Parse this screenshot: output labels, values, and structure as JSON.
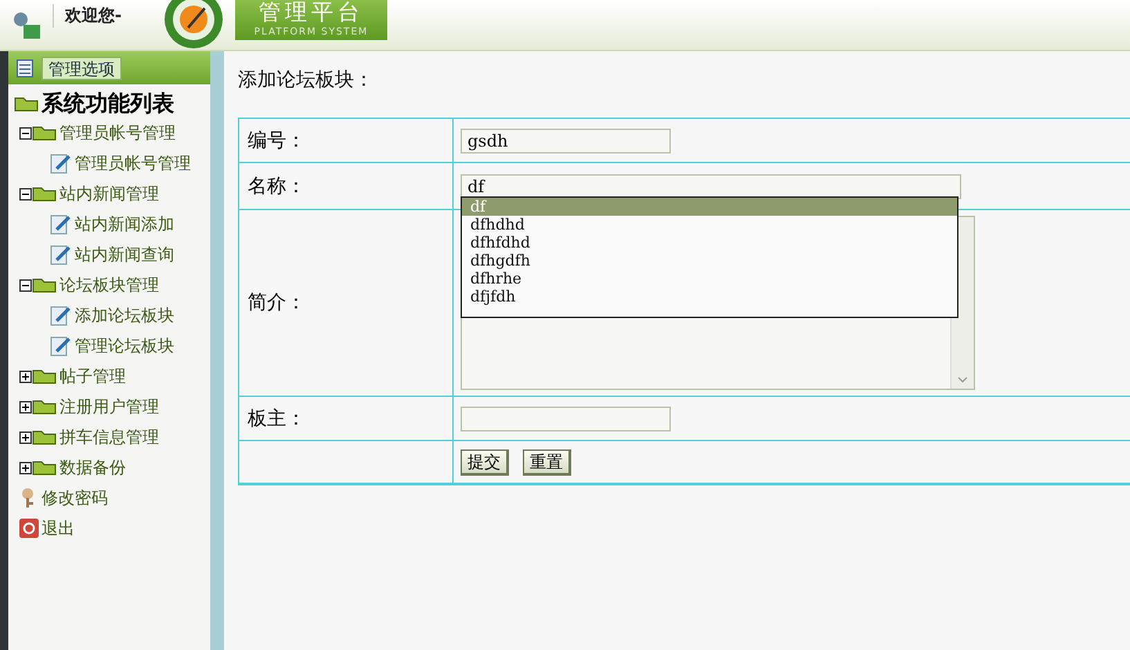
{
  "header": {
    "welcome": "欢迎您-",
    "logo_title": "管理平台",
    "logo_subtitle": "PLATFORM SYSTEM"
  },
  "sidebar": {
    "header_button": "管理选项",
    "tree": {
      "title": "系统功能列表",
      "children": [
        {
          "kind": "folder",
          "label": "管理员帐号管理",
          "expanded": true,
          "children": [
            {
              "kind": "page",
              "label": "管理员帐号管理"
            }
          ]
        },
        {
          "kind": "folder",
          "label": "站内新闻管理",
          "expanded": true,
          "children": [
            {
              "kind": "page",
              "label": "站内新闻添加"
            },
            {
              "kind": "page",
              "label": "站内新闻查询"
            }
          ]
        },
        {
          "kind": "folder",
          "label": "论坛板块管理",
          "expanded": true,
          "children": [
            {
              "kind": "page",
              "label": "添加论坛板块"
            },
            {
              "kind": "page",
              "label": "管理论坛板块"
            }
          ]
        },
        {
          "kind": "folder",
          "label": "帖子管理",
          "expanded": false
        },
        {
          "kind": "folder",
          "label": "注册用户管理",
          "expanded": false
        },
        {
          "kind": "folder",
          "label": "拼车信息管理",
          "expanded": false
        },
        {
          "kind": "folder",
          "label": "数据备份",
          "expanded": false
        },
        {
          "kind": "key",
          "label": "修改密码"
        },
        {
          "kind": "exit",
          "label": "退出"
        }
      ]
    }
  },
  "main": {
    "title": "添加论坛板块：",
    "fields": [
      {
        "kind": "short",
        "label": "编号：",
        "value": "gsdh"
      },
      {
        "kind": "long",
        "label": "名称：",
        "value": "df"
      },
      {
        "kind": "textarea",
        "label": "简介："
      },
      {
        "kind": "short",
        "label": "板主："
      },
      {
        "kind": "buttons",
        "buttons": [
          "提交",
          "重置"
        ]
      }
    ],
    "autocomplete": {
      "items": [
        {
          "text": "df",
          "selected": true
        },
        {
          "text": "dfhdhd",
          "selected": false
        },
        {
          "text": "dfhfdhd",
          "selected": false
        },
        {
          "text": "dfhgdfh",
          "selected": false
        },
        {
          "text": "dfhrhe",
          "selected": false
        },
        {
          "text": "dfjfdh",
          "selected": false
        }
      ]
    }
  }
}
